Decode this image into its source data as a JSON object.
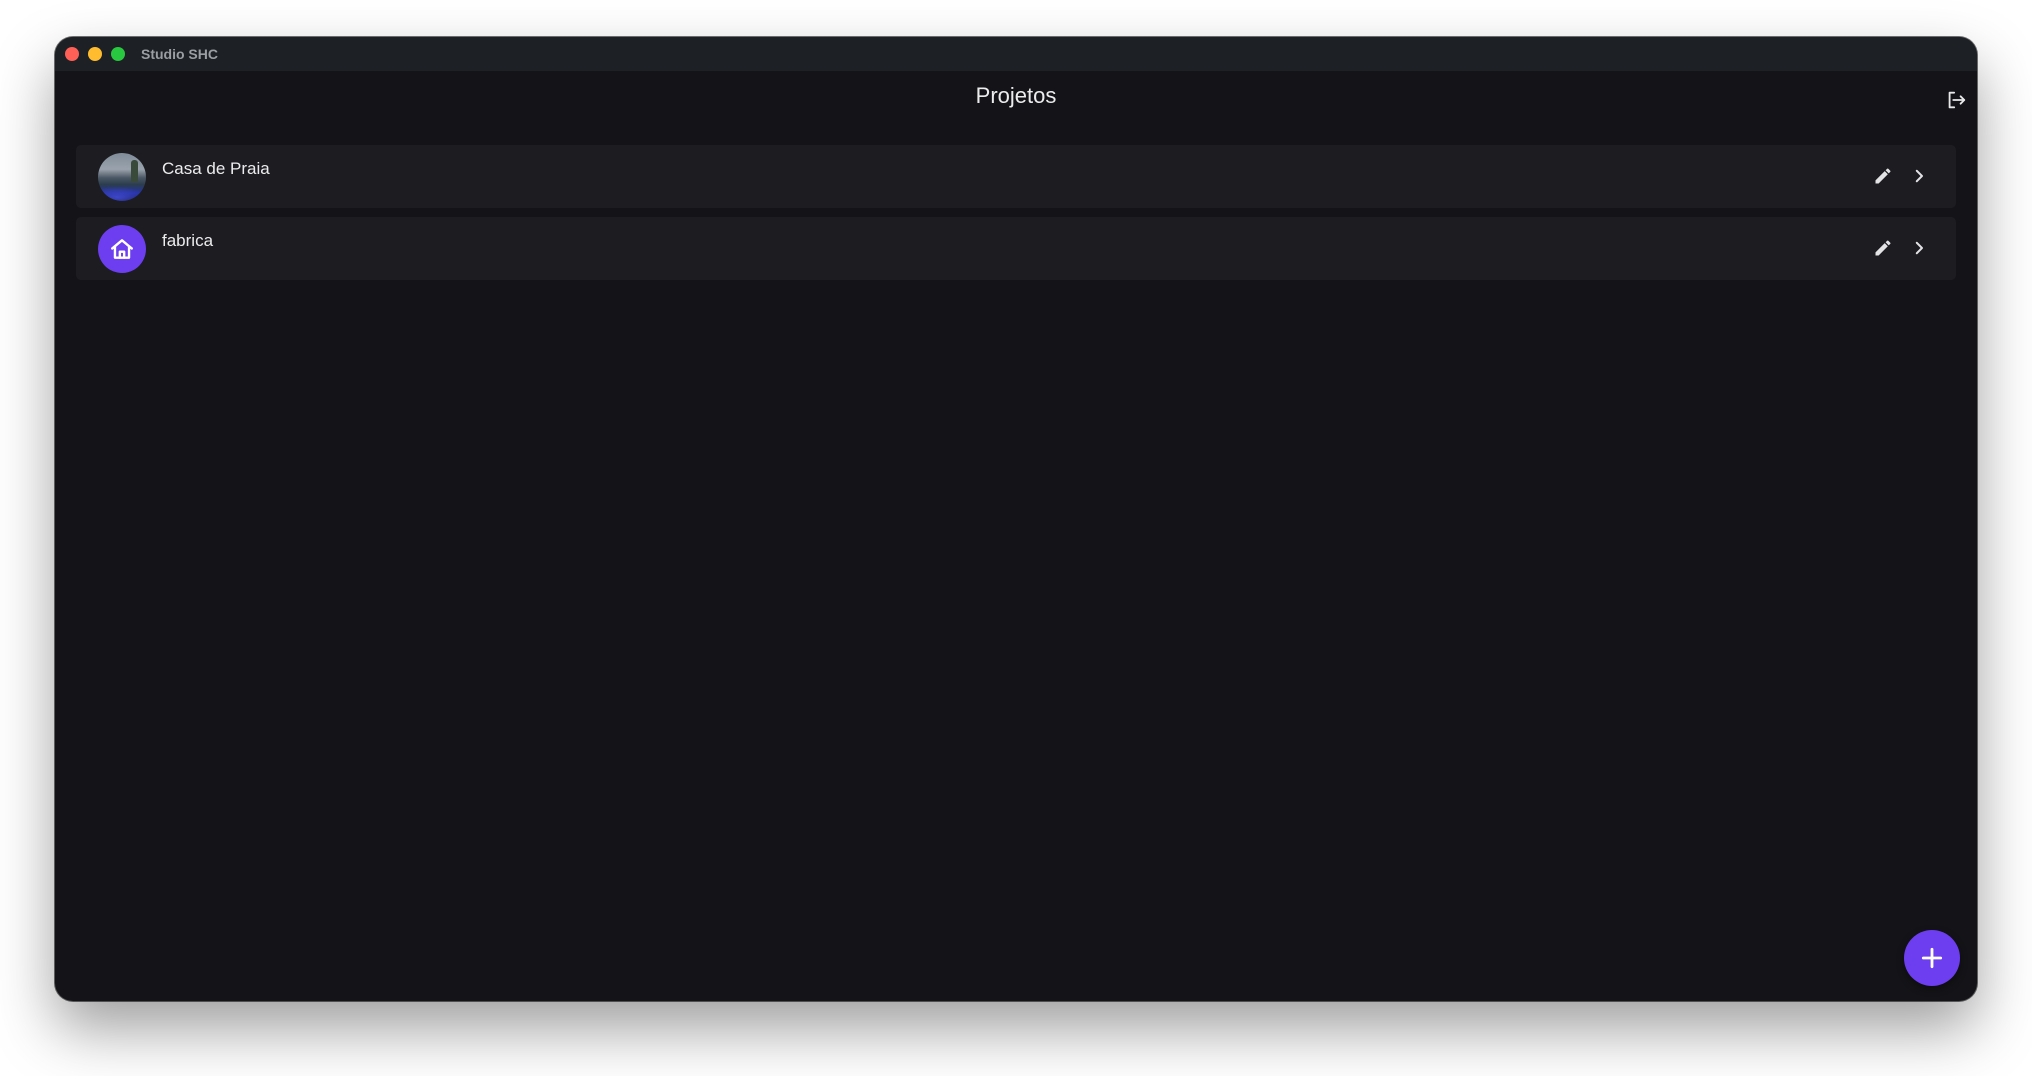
{
  "window": {
    "app_title": "Studio SHC"
  },
  "header": {
    "title": "Projetos",
    "logout_icon": "logout-icon"
  },
  "projects": [
    {
      "name": "Casa de Praia",
      "avatar": "photo",
      "edit_icon": "pencil-icon",
      "open_icon": "chevron-right-icon"
    },
    {
      "name": "fabrica",
      "avatar": "home-icon",
      "edit_icon": "pencil-icon",
      "open_icon": "chevron-right-icon"
    }
  ],
  "fab": {
    "icon": "plus-icon"
  },
  "colors": {
    "accent": "#6c3ef0",
    "background": "#141418",
    "row_background": "#1c1c21",
    "titlebar": "#1d2024",
    "text": "#ececee"
  }
}
